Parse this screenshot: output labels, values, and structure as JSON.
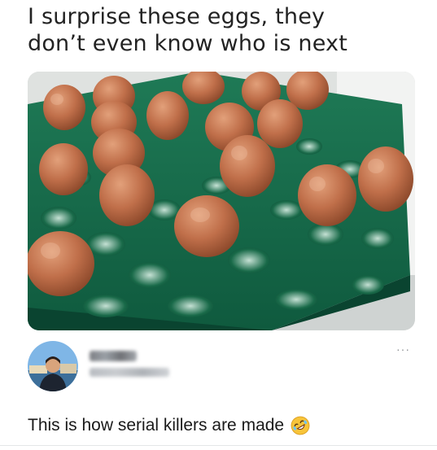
{
  "caption": "I surprise these eggs, they\ndon’t even know who is next",
  "photo": {
    "icon": "egg-tray-photo"
  },
  "author": {
    "avatar_icon": "avatar",
    "more_label": "···"
  },
  "tweet": {
    "text": "This is how serial killers are made",
    "emoji_icon": "rolling-on-floor-laughing-emoji"
  }
}
